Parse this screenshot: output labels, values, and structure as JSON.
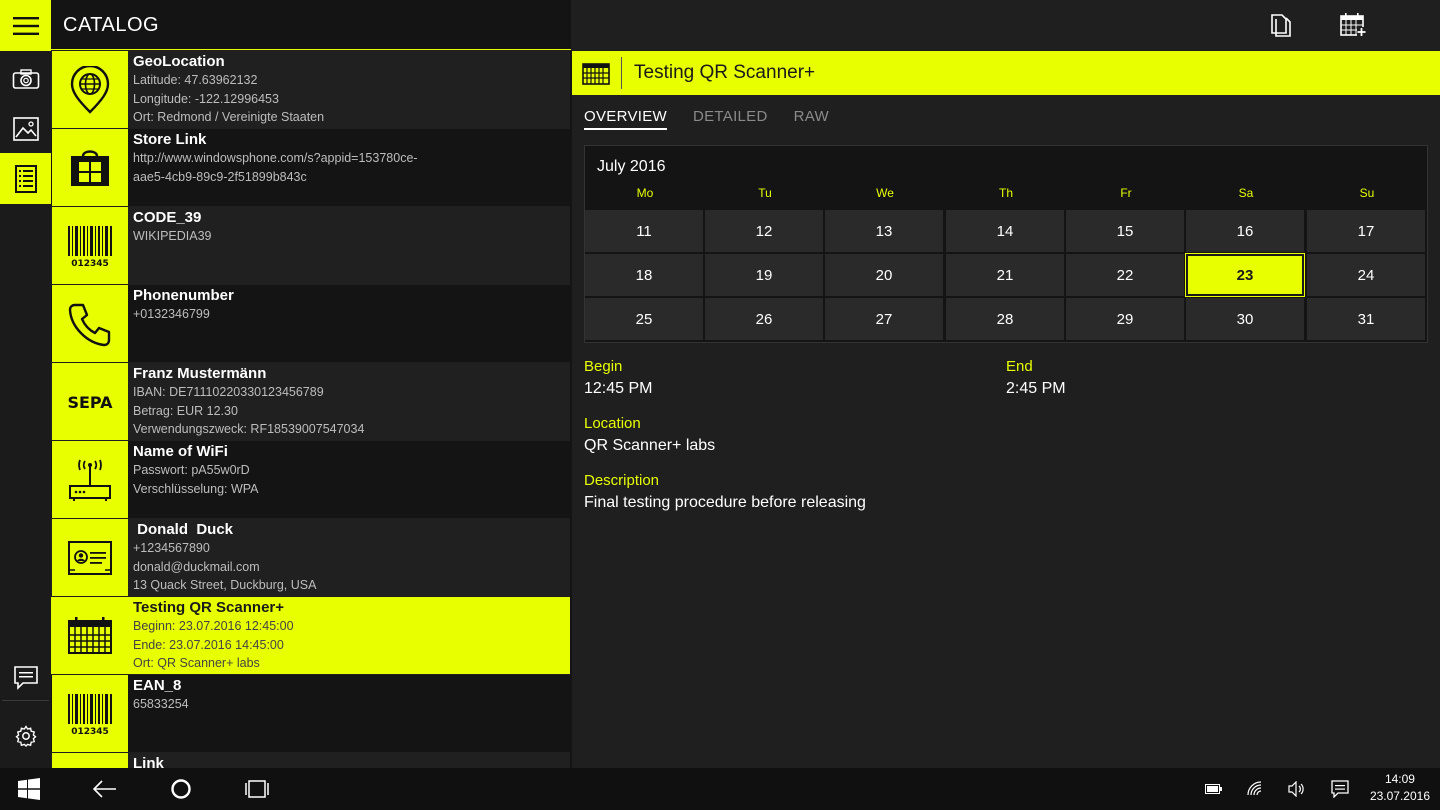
{
  "header": {
    "title": "CATALOG"
  },
  "rail": {
    "icons": [
      "menu-icon",
      "camera-icon",
      "image-icon",
      "catalog-icon",
      "feedback-icon",
      "gear-icon"
    ]
  },
  "list": [
    {
      "title": "GeoLocation",
      "icon": "globe-pin-icon",
      "lines": [
        "Latitude: 47.63962132",
        "Longitude: -122.12996453",
        "Ort: Redmond / Vereinigte Staaten"
      ]
    },
    {
      "title": "Store Link",
      "icon": "store-icon",
      "lines": [
        "http://www.windowsphone.com/s?appid=153780ce-",
        "aae5-4cb9-89c9-2f51899b843c"
      ]
    },
    {
      "title": "CODE_39",
      "icon": "barcode-icon",
      "lines": [
        "WIKIPEDIA39"
      ]
    },
    {
      "title": "Phonenumber",
      "icon": "phone-icon",
      "lines": [
        "+0132346799"
      ]
    },
    {
      "title": "Franz Mustermänn",
      "icon": "sepa-icon",
      "lines": [
        "IBAN: DE71110220330123456789",
        "Betrag: EUR 12.30",
        "Verwendungszweck: RF18539007547034"
      ]
    },
    {
      "title": "Name of WiFi",
      "icon": "wifi-router-icon",
      "lines": [
        "Passwort: pA55w0rD",
        "Verschlüsselung: WPA"
      ]
    },
    {
      "title": " Donald  Duck",
      "icon": "contact-card-icon",
      "lines": [
        "+1234567890",
        "donald@duckmail.com",
        "13 Quack Street, Duckburg, USA"
      ]
    },
    {
      "title": "Testing QR Scanner+",
      "icon": "calendar-icon",
      "lines": [
        "Beginn: 23.07.2016 12:45:00",
        "Ende: 23.07.2016 14:45:00",
        "Ort: QR Scanner+ labs"
      ]
    },
    {
      "title": "EAN_8",
      "icon": "barcode-icon",
      "lines": [
        "65833254"
      ]
    },
    {
      "title": "Link",
      "icon": "link-icon",
      "lines": []
    }
  ],
  "sepa_label": "SEPA",
  "barcode_digits": "012345",
  "detail": {
    "title": "Testing QR Scanner+",
    "tabs": [
      "OVERVIEW",
      "DETAILED",
      "RAW"
    ],
    "calendar": {
      "month": "July 2016",
      "weekdays": [
        "Mo",
        "Tu",
        "We",
        "Th",
        "Fr",
        "Sa",
        "Su"
      ],
      "weeks": [
        [
          "11",
          "12",
          "13",
          "14",
          "15",
          "16",
          "17"
        ],
        [
          "18",
          "19",
          "20",
          "21",
          "22",
          "23",
          "24"
        ],
        [
          "25",
          "26",
          "27",
          "28",
          "29",
          "30",
          "31"
        ]
      ],
      "selected": "23"
    },
    "begin_label": "Begin",
    "begin_value": "12:45 PM",
    "end_label": "End",
    "end_value": "2:45 PM",
    "location_label": "Location",
    "location_value": "QR Scanner+ labs",
    "description_label": "Description",
    "description_value": "Final testing procedure before releasing"
  },
  "taskbar": {
    "time": "14:09",
    "date": "23.07.2016"
  },
  "colors": {
    "accent": "#e8ff00",
    "bg": "#1f1f1f",
    "dark": "#141414"
  }
}
